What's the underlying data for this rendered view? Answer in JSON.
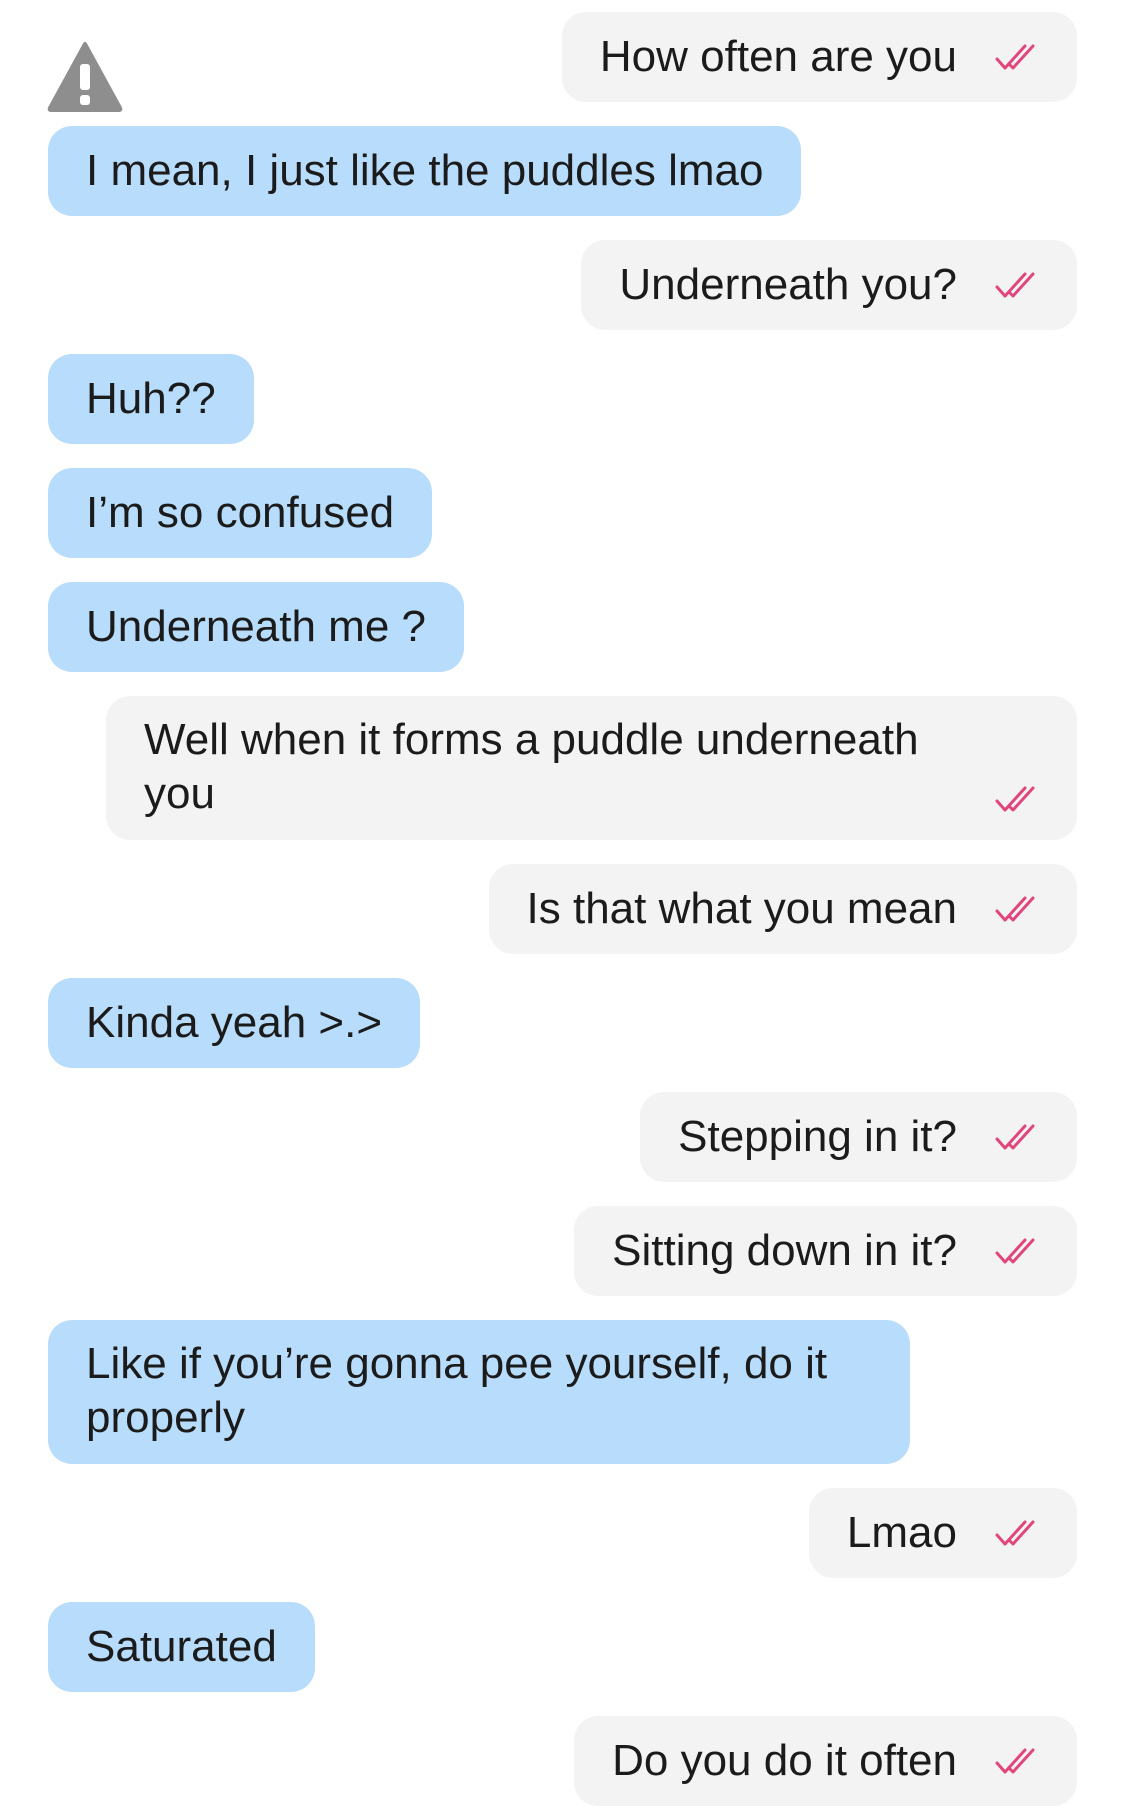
{
  "colors": {
    "incoming_bubble": "#b8dcfb",
    "outgoing_bubble": "#f3f3f3",
    "read_receipt": "#e0457b",
    "warning_icon": "#8e8e8e",
    "text": "#1b1b1b"
  },
  "icons": {
    "warning": "warning-triangle-icon",
    "read": "double-check-icon"
  },
  "messages": [
    {
      "from": "me",
      "text": "How often are you",
      "read": true
    },
    {
      "from": "them",
      "text": "I mean, I just like the puddles lmao"
    },
    {
      "from": "me",
      "text": "Underneath you?",
      "read": true
    },
    {
      "from": "them",
      "text": "Huh??"
    },
    {
      "from": "them",
      "text": "I’m so confused"
    },
    {
      "from": "them",
      "text": "Underneath me ?"
    },
    {
      "from": "me",
      "text": "Well when it forms a puddle underneath you",
      "read": true
    },
    {
      "from": "me",
      "text": "Is that what you mean",
      "read": true
    },
    {
      "from": "them",
      "text": "Kinda yeah >.>"
    },
    {
      "from": "me",
      "text": "Stepping in it?",
      "read": true
    },
    {
      "from": "me",
      "text": "Sitting down in it?",
      "read": true
    },
    {
      "from": "them",
      "text": "Like if you’re gonna pee yourself, do it properly"
    },
    {
      "from": "me",
      "text": "Lmao",
      "read": true
    },
    {
      "from": "them",
      "text": "Saturated"
    },
    {
      "from": "me",
      "text": "Do you do it often",
      "read": true
    }
  ]
}
